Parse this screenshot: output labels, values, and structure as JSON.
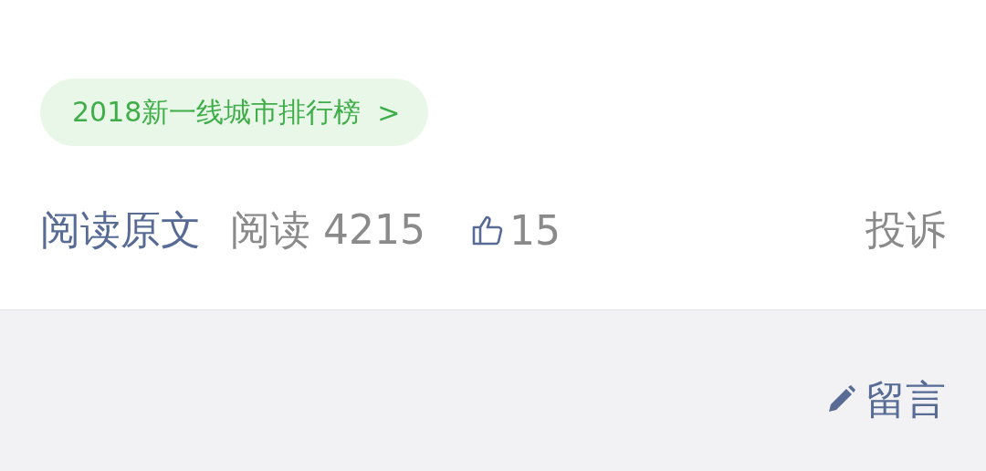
{
  "tag": {
    "label": "2018新一线城市排行榜",
    "arrow": ">"
  },
  "footer": {
    "read_original": "阅读原文",
    "reads": "阅读 4215",
    "likes": "15",
    "report": "投诉"
  },
  "comment": {
    "label": "留言"
  }
}
